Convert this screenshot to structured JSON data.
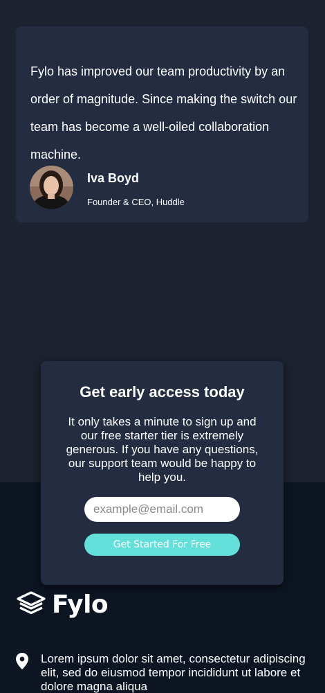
{
  "testimonial": {
    "quote": "Fylo has improved our team productivity by an order of magnitude. Since making the switch our team has become a well-oiled collaboration machine.",
    "name": "Iva Boyd",
    "role": "Founder & CEO, Huddle"
  },
  "cta": {
    "title": "Get early access today",
    "text": "It only takes a minute to sign up and our free starter tier is extremely generous. If you have any questions, our support team would be happy to help you.",
    "email_placeholder": "example@email.com",
    "button_label": "Get Started For Free"
  },
  "footer": {
    "logo_text": "Fylo",
    "address": "Lorem ipsum dolor sit amet, consectetur adipiscing elit, sed do eiusmod tempor incididunt ut labore et dolore magna aliqua",
    "icons": {
      "logo": "layers-icon",
      "address": "location-pin-icon"
    }
  },
  "colors": {
    "page_bg": "#1c2230",
    "card_bg": "#232c40",
    "footer_bg": "#0d1523",
    "accent": "#62e0d9"
  }
}
